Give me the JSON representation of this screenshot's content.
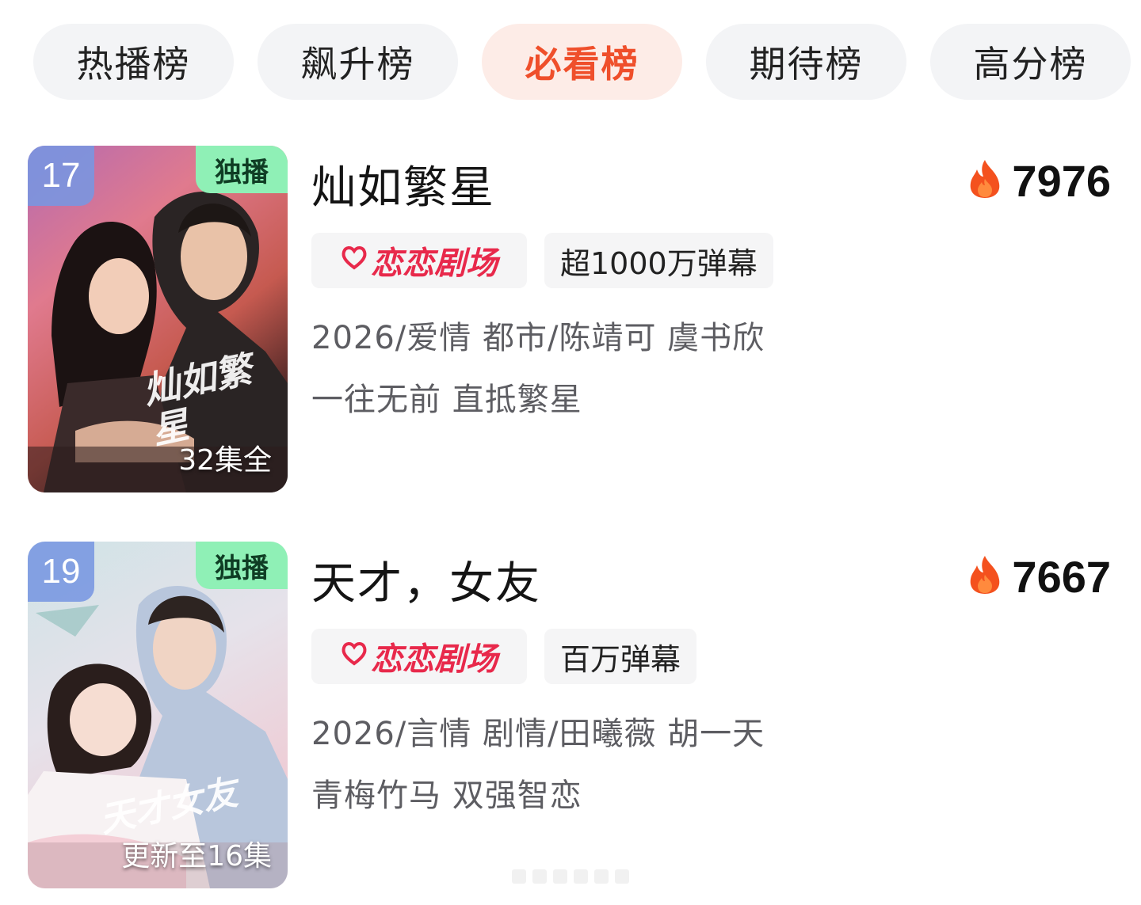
{
  "tabs": [
    {
      "label": "热播榜"
    },
    {
      "label": "飙升榜"
    },
    {
      "label": "必看榜"
    },
    {
      "label": "期待榜"
    },
    {
      "label": "高分榜"
    }
  ],
  "active_tab": "必看榜",
  "items": [
    {
      "rank": "17",
      "exclusive_label": "独播",
      "episode_status": "32集全",
      "poster_title": "灿如繁星",
      "title": "灿如繁星",
      "heat": "7976",
      "brand_tag": "恋恋剧场",
      "danmu_tag": "超1000万弹幕",
      "meta": "2026/爱情 都市/陈靖可 虞书欣",
      "slogan": "一往无前 直抵繁星"
    },
    {
      "rank": "19",
      "exclusive_label": "独播",
      "episode_status": "更新至16集",
      "poster_title": "天才女友",
      "title": "天才，女友",
      "heat": "7667",
      "brand_tag": "恋恋剧场",
      "danmu_tag": "百万弹幕",
      "meta": "2026/言情 剧情/田曦薇 胡一天",
      "slogan": "青梅竹马 双强智恋"
    }
  ],
  "colors": {
    "accent": "#ef4f2b",
    "brand": "#e8294b",
    "exclusive_badge": "#8ff0b6",
    "rank_badge": "#7896e1"
  },
  "icons": {
    "heat": "flame-icon",
    "brand": "heart-logo-icon"
  }
}
